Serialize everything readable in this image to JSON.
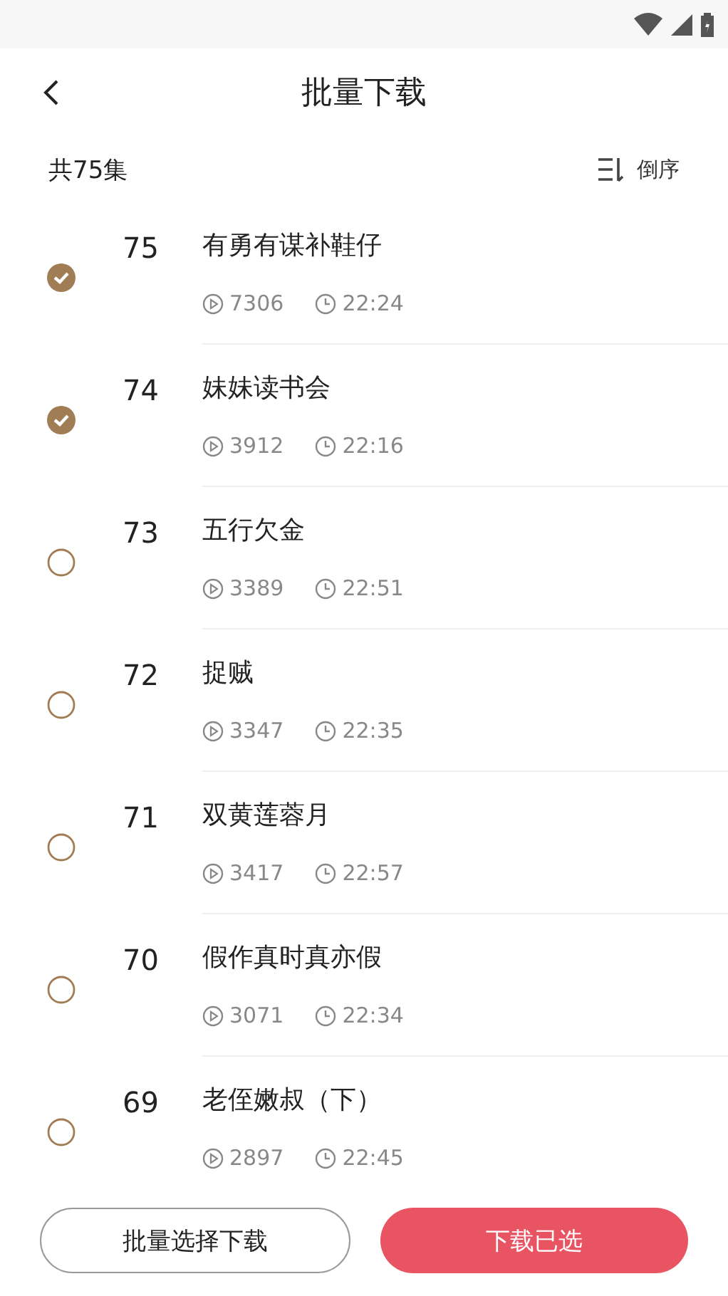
{
  "header": {
    "title": "批量下载"
  },
  "summary": {
    "count": "共75集",
    "sort_label": "倒序"
  },
  "episodes": [
    {
      "number": "75",
      "title": "有勇有谋补鞋仔",
      "plays": "7306",
      "duration": "22:24",
      "selected": true
    },
    {
      "number": "74",
      "title": "妹妹读书会",
      "plays": "3912",
      "duration": "22:16",
      "selected": true
    },
    {
      "number": "73",
      "title": "五行欠金",
      "plays": "3389",
      "duration": "22:51",
      "selected": false
    },
    {
      "number": "72",
      "title": "捉贼",
      "plays": "3347",
      "duration": "22:35",
      "selected": false
    },
    {
      "number": "71",
      "title": "双黄莲蓉月",
      "plays": "3417",
      "duration": "22:57",
      "selected": false
    },
    {
      "number": "70",
      "title": "假作真时真亦假",
      "plays": "3071",
      "duration": "22:34",
      "selected": false
    },
    {
      "number": "69",
      "title": "老侄嫩叔（下）",
      "plays": "2897",
      "duration": "22:45",
      "selected": false
    }
  ],
  "buttons": {
    "batch_select": "批量选择下载",
    "download_selected": "下载已选"
  }
}
